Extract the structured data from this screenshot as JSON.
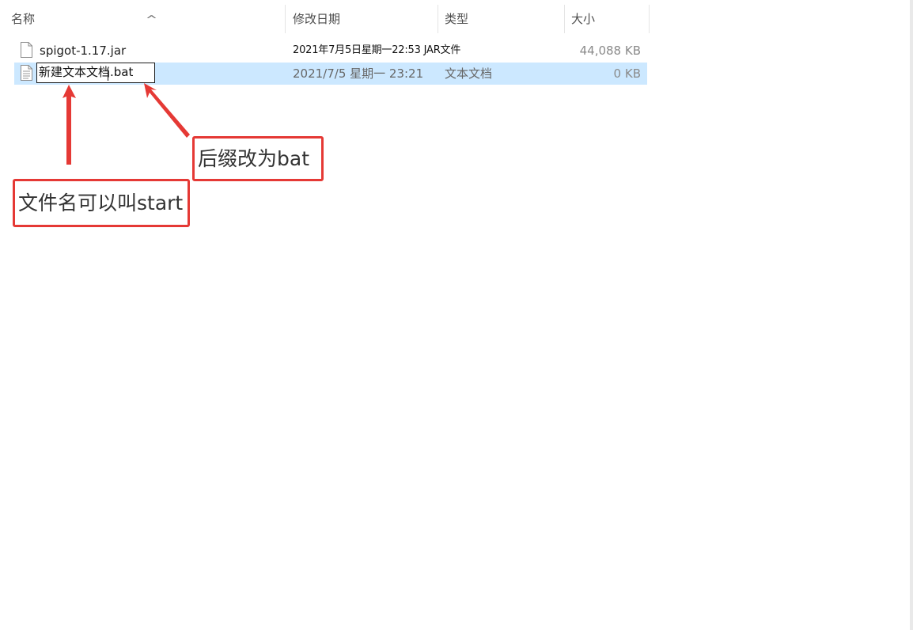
{
  "columns": {
    "name": "名称",
    "date": "修改日期",
    "type": "类型",
    "size": "大小"
  },
  "files": [
    {
      "name": "spigot-1.17.jar",
      "date": "2021年7月5日星期一22:53 JAR文件",
      "type": "",
      "size": "44,088 KB",
      "icon": "blank-file-icon"
    },
    {
      "name": "新建文本文档.bat",
      "date": "2021/7/5 星期一 23:21",
      "type": "文本文档",
      "size": "0 KB",
      "icon": "text-file-icon",
      "selected": true,
      "renaming": true
    }
  ],
  "annotations": {
    "suffix_note": "后缀改为bat",
    "filename_note": "文件名可以叫start"
  },
  "colors": {
    "selection": "#cce8ff",
    "callout_border": "#e53935",
    "arrow": "#e53935"
  }
}
